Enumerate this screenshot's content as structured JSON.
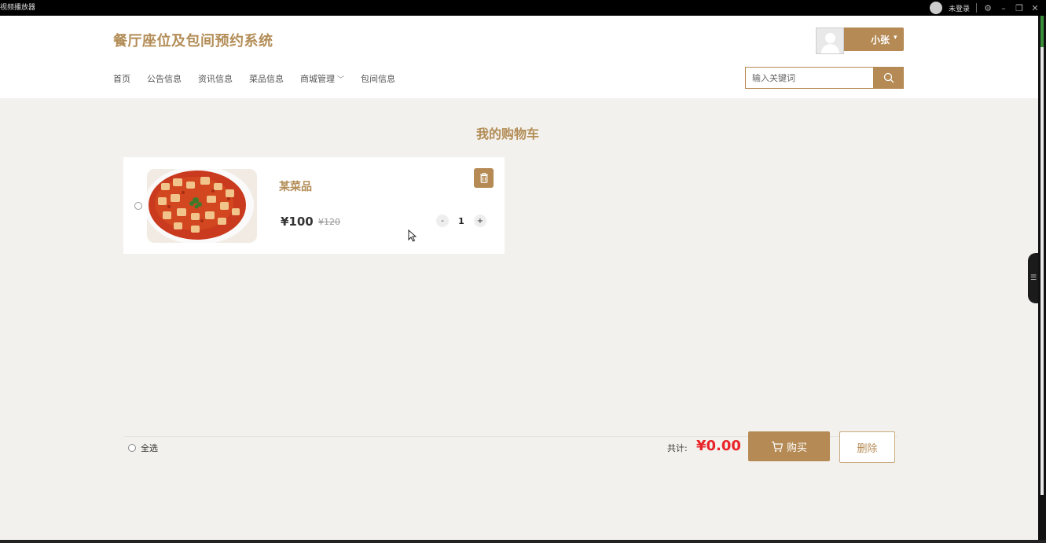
{
  "window": {
    "app_title": "视频播放器",
    "login_status": "未登录"
  },
  "header": {
    "site_title": "餐厅座位及包间预约系统",
    "user_name": "小张",
    "nav": [
      {
        "label": "首页"
      },
      {
        "label": "公告信息"
      },
      {
        "label": "资讯信息"
      },
      {
        "label": "菜品信息"
      },
      {
        "label": "商城管理",
        "has_dropdown": true
      },
      {
        "label": "包间信息"
      }
    ],
    "search_placeholder": "输入关键词"
  },
  "cart": {
    "title": "我的购物车",
    "items": [
      {
        "name": "某菜品",
        "price": "¥100",
        "original_price": "¥120",
        "quantity": "1",
        "minus": "-",
        "plus": "+"
      }
    ],
    "select_all_label": "全选",
    "total_label": "共计:",
    "total_value": "¥0.00",
    "buy_label": "购买",
    "delete_label": "删除"
  },
  "colors": {
    "accent": "#b58a54",
    "title": "#b38d57",
    "total": "#e8242a",
    "page_bg": "#f2f1ed"
  }
}
